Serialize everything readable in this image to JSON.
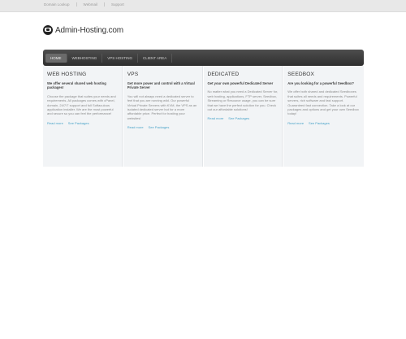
{
  "topbar": {
    "links": [
      "Domain Lookup",
      "Webmail",
      "Support"
    ]
  },
  "logo": {
    "text": "Admin-Hosting.com"
  },
  "nav": {
    "items": [
      {
        "label": "Home",
        "active": true
      },
      {
        "label": "Webhosting",
        "active": false
      },
      {
        "label": "VPS Hosting",
        "active": false
      },
      {
        "label": "Client Area",
        "active": false
      }
    ]
  },
  "columns": [
    {
      "title": "WEB HOSTING",
      "lead": "We offer several shared web hosting packages!",
      "body": "Choose the package that suites your needs and requirements. All packages comes with cPanel, domain, 24/7/7 support and full Softaculous application installer. We are the most powerful and secure so you can feel the performance!",
      "links": [
        "Read more",
        "See Packages"
      ]
    },
    {
      "title": "VPS",
      "lead": "Get more power and control with a Virtual Private Server",
      "body": "You will not always need a dedicated server to feel that you are running wild. Our powerful Virtual Private Servers with KVM, the VPS as an isolated dedicated server but for a more affordable price. Perfect for hosting your websites!",
      "links": [
        "Read more",
        "See Packages"
      ]
    },
    {
      "title": "DEDICATED",
      "lead": "Get your own powerful Dedicated Server",
      "body": "No matter what you need a Dedicated Server for, web hosting, applications, FTP server, Seedbox, Streaming or Resource usage, you can be sure that we have the perfect solution for you. Check out our affordable solutions!",
      "links": [
        "Read more",
        "See Packages"
      ]
    },
    {
      "title": "SEEDBOX",
      "lead": "Are you looking for a powerful Seedbox?",
      "body": "We offer both shared and dedicated Seedboxes that suites all needs and requirements. Powerful servers, rich software and fast support. Guaranteed fast connection. Take a look at our packages and options and get your own Seedbox today!",
      "links": [
        "Read more",
        "See Packages"
      ]
    }
  ]
}
